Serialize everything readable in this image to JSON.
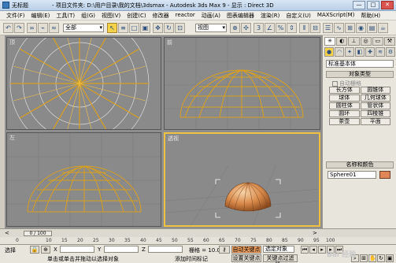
{
  "window": {
    "doc_name": "无标题",
    "title": "- 项目文件夹: D:\\用户目录\\我的文档\\3dsmax - Autodesk 3ds Max 9 - 显示 : Direct 3D",
    "min_label": "—",
    "max_label": "□",
    "close_label": "✕"
  },
  "menu": [
    "文件(F)",
    "编辑(E)",
    "工具(T)",
    "组(G)",
    "视图(V)",
    "创建(C)",
    "修改器",
    "reactor",
    "动画(A)",
    "图表编辑器",
    "渲染(R)",
    "自定义(U)",
    "MAXScript(M)",
    "帮助(H)"
  ],
  "toolbar": {
    "selection_filter": "全部",
    "coord_system": "视图"
  },
  "viewports": {
    "top": {
      "label": "顶"
    },
    "front": {
      "label": "前"
    },
    "left": {
      "label": "左"
    },
    "perspective": {
      "label": "透视"
    }
  },
  "command_panel": {
    "category": "标准基本体",
    "object_type_title": "对象类型",
    "autogrid": "自动栅格",
    "buttons": [
      "长方体",
      "圆锥体",
      "球体",
      "几何球体",
      "圆柱体",
      "管状体",
      "圆环",
      "四棱锥",
      "茶壶",
      "平面"
    ],
    "name_color_title": "名称和颜色",
    "object_name": "Sphere01"
  },
  "timeline": {
    "frame_display": "0 / 100",
    "ticks": [
      "0",
      "10",
      "15",
      "20",
      "25",
      "30",
      "35",
      "40",
      "45",
      "50",
      "55",
      "60",
      "65",
      "70",
      "75",
      "80",
      "85",
      "90",
      "95",
      "100"
    ]
  },
  "status": {
    "selection_label": "选择",
    "x_label": "X",
    "y_label": "Y",
    "z_label": "Z",
    "grid_label": "栅格 = 10.0",
    "autokey_label": "自动关键点",
    "selected_label": "选定对象",
    "setkey_label": "设置关键点",
    "keyfilter_label": "关键点过滤器...",
    "prompt": "单击或单击并拖动以选择对象",
    "add_time_tag": "添加时间标记"
  },
  "watermark": "Bai 经验"
}
